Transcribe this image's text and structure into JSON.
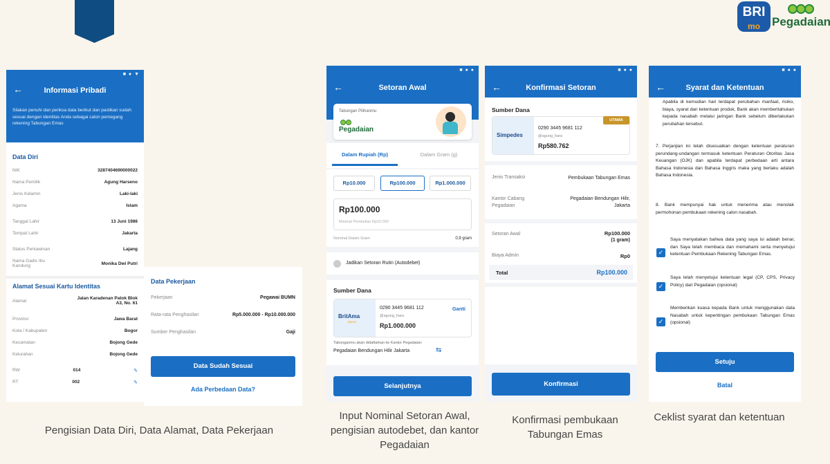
{
  "brand": {
    "bri": "BRI",
    "mo": "mo",
    "pegadaian": "Pegadaian"
  },
  "screen1": {
    "title": "Informasi Pribadi",
    "intro": "Silakan penuhi dan periksa data berikut dan pastikan sudah sesuai dengan identitas Anda sebagai calon pemegang rekening Tabungan Emas",
    "data_diri_title": "Data Diri",
    "data_diri": [
      {
        "label": "NIK",
        "value": "3287404690000022"
      },
      {
        "label": "Nama Pemilik",
        "value": "Agung Harseno"
      },
      {
        "label": "Jenis Kelamin",
        "value": "Laki-laki"
      },
      {
        "label": "Agama",
        "value": "Islam"
      },
      {
        "label": "Tanggal Lahir",
        "value": "13 Juni 1986"
      },
      {
        "label": "Tempat Lahir",
        "value": "Jakarta"
      },
      {
        "label": "Status Perkawinan",
        "value": "Lajang"
      },
      {
        "label": "Nama Gadis Ibu Kandung",
        "value": "Monika Dwi Putri"
      }
    ],
    "alamat_title": "Alamat Sesuai Kartu Identitas",
    "alamat": [
      {
        "label": "Alamat",
        "value": "Jalan Karadenan Patok Blok A3, No. 61"
      },
      {
        "label": "Provinsi",
        "value": "Jawa Barat"
      },
      {
        "label": "Kota / Kabupaten",
        "value": "Bogor"
      },
      {
        "label": "Kecamatan",
        "value": "Bojong Gede"
      },
      {
        "label": "Kelurahan",
        "value": "Bojong Gede"
      },
      {
        "label": "RW",
        "value": "014"
      },
      {
        "label": "RT",
        "value": "002"
      }
    ]
  },
  "screen1b": {
    "title": "Data Pekerjaan",
    "rows": [
      {
        "label": "Pekerjaan",
        "value": "Pegawai BUMN"
      },
      {
        "label": "Rata-rata Penghasilan",
        "value": "Rp5.000.000 - Rp10.000.000"
      },
      {
        "label": "Sumber Penghasilan",
        "value": "Gaji"
      }
    ],
    "primary_btn": "Data Sudah Sesuai",
    "secondary_link": "Ada Perbedaan Data?"
  },
  "screen2": {
    "title": "Setoran Awal",
    "product_label": "Tabungan Pilihanmu",
    "product_name": "Pegadaian",
    "tab_rupiah": "Dalam Rupiah (Rp)",
    "tab_gram": "Dalam Gram (g)",
    "chips": [
      "Rp10.000",
      "Rp100.000",
      "Rp1.000.000"
    ],
    "amount": "Rp100.000",
    "min_note": "Minimal Pembelian Rp10.000",
    "gram_label": "Nominal Dalam Gram",
    "gram_value": "0,9 gram",
    "autodebet": "Jadikan Setoran Rutin (Autodebet)",
    "source_title": "Sumber Dana",
    "card_brand": "BritAma",
    "card_brand_sub": "Bisnis",
    "account": "0290 3445 9681 112",
    "handle": "@agung_hara",
    "balance": "Rp1.000.000",
    "change": "Ganti",
    "branch_note": "Tabunganmu akan didaftarkan ke Kantor Pegadaian:",
    "branch": "Pegadaian Bendungan Hilir Jakarta",
    "next_btn": "Selanjutnya"
  },
  "screen3": {
    "title": "Konfirmasi Setoran",
    "source_title": "Sumber Dana",
    "badge": "UTAMA",
    "card_brand": "Simpedes",
    "account": "0290 3445 9681 112",
    "handle": "@agung_hara",
    "balance": "Rp580.762",
    "rows1": [
      {
        "label": "Jenis Transaksi",
        "value": "Pembukaan Tabungan Emas"
      },
      {
        "label": "Kantor Cabang Pegadaian",
        "value": "Pegadaian Bendungan Hilir, Jakarta"
      }
    ],
    "setoran_label": "Setoran Awal",
    "setoran_value": "Rp100.000",
    "setoran_sub": "(1 gram)",
    "admin_label": "Biaya Admin",
    "admin_value": "Rp0",
    "total_label": "Total",
    "total_value": "Rp100.000",
    "confirm_btn": "Konfirmasi"
  },
  "screen4": {
    "title": "Syarat dan Ketentuan",
    "para_top": "Apabila di kemudian hari terdapat perubahan manfaat, risiko, biaya, syarat dan ketentuan produk, Bank akan memberitahukan kepada nasabah melalui jaringan Bank sebelum diberlakukan perubahan tersebut.",
    "item7": "7. Perjanjian ini telah disesuaikan dengan ketentuan peraturan perundang-undangan termasuk ketentuan Peraturan Otoritas Jasa Keuangan (OJK) dan apabila terdapat perbedaan arti antara Bahasa Indonesia dan Bahasa Inggris maka yang berlaku adalah Bahasa Indonesia.",
    "item8": "8. Bank mempunyai hak untuk menerima atau menolak permohonan pembukaan rekening calon nasabah.",
    "checks": [
      "Saya menyatakan bahwa data yang saya isi adalah benar, dan Saya telah membaca dan memahami serta menyetujui ketentuan Pembukaan Rekening Tabungan Emas.",
      "Saya telah menyetujui ketentuan legal (CP, CPS, Privacy Policy) dari Pegadaian (opsional)",
      "Memberikan kuasa kepada Bank untuk menggunakan data Nasabah untuk kepentingan pembukaan Tabungan Emas (opsional)"
    ],
    "agree_btn": "Setuju",
    "cancel_link": "Batal"
  },
  "captions": {
    "c1": "Pengisian Data Diri, Data Alamat, Data Pekerjaan",
    "c2": "Input Nominal Setoran Awal, pengisian autodebet, dan kantor Pegadaian",
    "c3": "Konfirmasi pembukaan Tabungan Emas",
    "c4": "Ceklist syarat dan ketentuan"
  },
  "colors": {
    "primary": "#1a6fc4",
    "navy": "#0f4c81",
    "background": "#faf5ec",
    "badge": "#c8952b"
  }
}
